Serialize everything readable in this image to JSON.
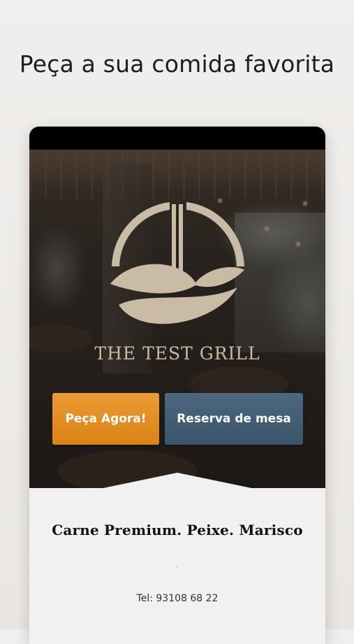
{
  "headline": "Peça a sua comida favorita",
  "brand": {
    "name": "THE TEST GRILL",
    "accent_color": "#c9bba4"
  },
  "buttons": {
    "order_label": "Peça Agora!",
    "order_color": "#e08c22",
    "reserve_label": "Reserva de mesa",
    "reserve_color": "#425d74"
  },
  "content": {
    "tagline": "Carne Premium. Peixe. Marisco",
    "separator": ".",
    "phone": "Tel: 93108 68 22"
  },
  "icons": {
    "logo": "fish-wave-logo"
  }
}
